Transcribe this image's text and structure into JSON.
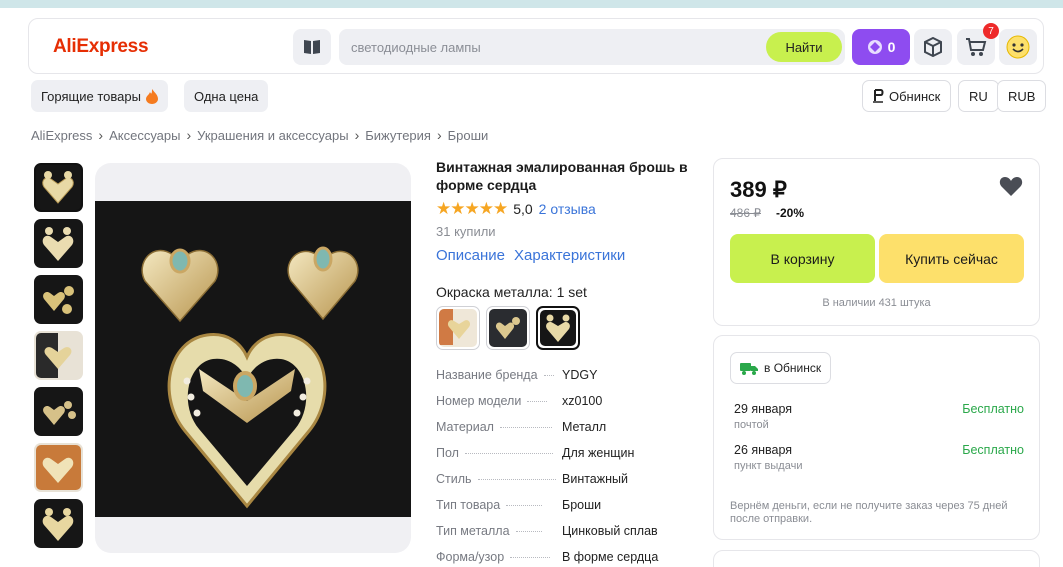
{
  "header": {
    "logo": "AliExpress",
    "search_placeholder": "светодиодные лампы",
    "search_button": "Найти",
    "coins_count": "0",
    "cart_count": "7"
  },
  "subnav": {
    "hot_deals": "Горящие товары",
    "one_price": "Одна цена",
    "city": "Обнинск",
    "language": "RU",
    "currency": "RUB"
  },
  "breadcrumb": [
    "AliExpress",
    "Аксессуары",
    "Украшения и аксессуары",
    "Бижутерия",
    "Броши"
  ],
  "product": {
    "title": "Винтажная эмалированная брошь в форме сердца",
    "stars": "★★★★★",
    "rating": "5,0",
    "reviews": "2 отзыва",
    "sold": "31 купили",
    "tab_description": "Описание",
    "tab_specs": "Характеристики",
    "color_label": "Окраска металла: 1 set",
    "specs": [
      {
        "key": "Название бренда",
        "value": "YDGY"
      },
      {
        "key": "Номер модели",
        "value": "xz0100"
      },
      {
        "key": "Материал",
        "value": "Металл"
      },
      {
        "key": "Пол",
        "value": "Для женщин"
      },
      {
        "key": "Стиль",
        "value": "Винтажный"
      },
      {
        "key": "Тип товара",
        "value": "Броши"
      },
      {
        "key": "Тип металла",
        "value": "Цинковый сплав"
      },
      {
        "key": "Форма/узор",
        "value": "В форме сердца"
      }
    ]
  },
  "purchase": {
    "price": "389 ₽",
    "old_price": "486 ₽",
    "discount": "-20%",
    "add_to_cart": "В корзину",
    "buy_now": "Купить сейчас",
    "stock": "В наличии 431 штука"
  },
  "delivery": {
    "city_label": "в Обнинск",
    "options": [
      {
        "date": "29 января",
        "method": "почтой",
        "price": "Бесплатно"
      },
      {
        "date": "26 января",
        "method": "пункт выдачи",
        "price": "Бесплатно"
      }
    ],
    "refund_note": "Вернём деньги, если не получите заказ через 75 дней после отправки."
  },
  "colors": {
    "accent_green": "#c8f04e",
    "accent_yellow": "#fde06b",
    "coins_purple": "#8e4cf0",
    "link_blue": "#3a74d9",
    "free_green": "#2aa84a",
    "logo_red": "#e62e04",
    "star_orange": "#f6a623"
  }
}
